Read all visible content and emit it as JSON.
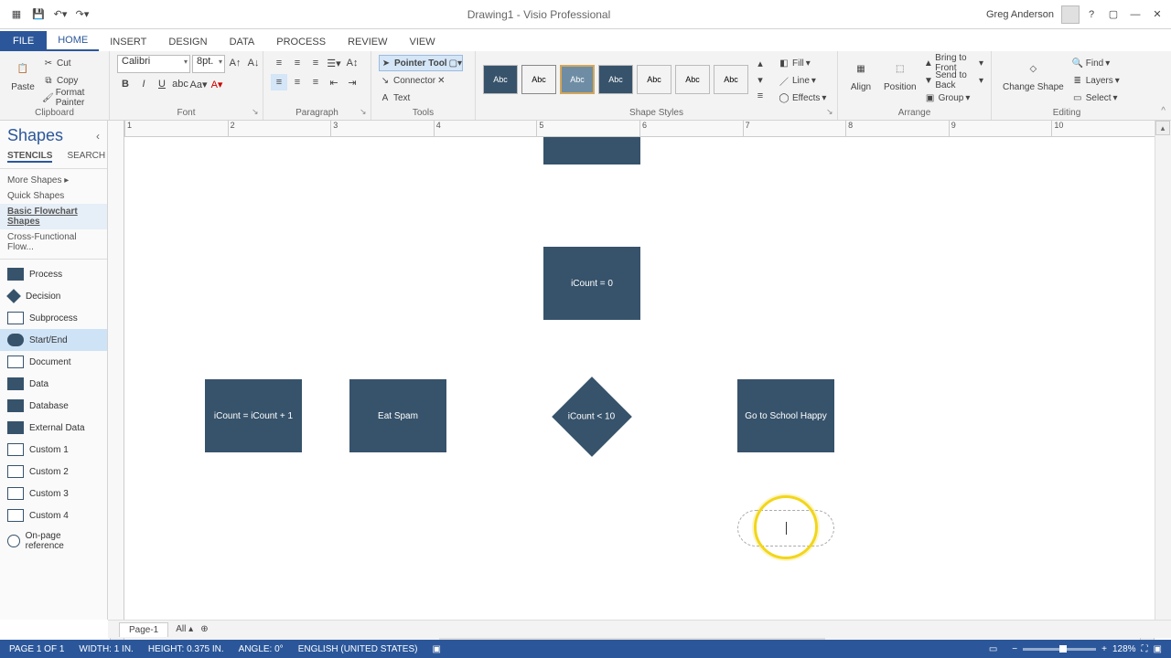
{
  "title": "Drawing1 - Visio Professional",
  "user": "Greg Anderson",
  "tabs": [
    "FILE",
    "HOME",
    "INSERT",
    "DESIGN",
    "DATA",
    "PROCESS",
    "REVIEW",
    "VIEW"
  ],
  "activeTab": "HOME",
  "ribbon": {
    "groups": {
      "clipboard": "Clipboard",
      "font": "Font",
      "paragraph": "Paragraph",
      "tools": "Tools",
      "styles": "Shape Styles",
      "arrange": "Arrange",
      "editing": "Editing"
    },
    "clipboard": {
      "paste": "Paste",
      "cut": "Cut",
      "copy": "Copy",
      "painter": "Format Painter"
    },
    "font": {
      "name": "Calibri",
      "size": "8pt."
    },
    "tools": {
      "pointer": "Pointer Tool",
      "connector": "Connector",
      "text": "Text"
    },
    "styles": {
      "fill": "Fill",
      "line": "Line",
      "effects": "Effects"
    },
    "arrange": {
      "align": "Align",
      "position": "Position",
      "bringfront": "Bring to Front",
      "sendback": "Send to Back",
      "group": "Group"
    },
    "editing": {
      "changeshape": "Change Shape",
      "find": "Find",
      "layers": "Layers",
      "select": "Select"
    }
  },
  "shapespane": {
    "title": "Shapes",
    "tabs": {
      "stencils": "STENCILS",
      "search": "SEARCH"
    },
    "groups": [
      "More Shapes",
      "Quick Shapes",
      "Basic Flowchart Shapes",
      "Cross-Functional Flow..."
    ],
    "selectedGroup": "Basic Flowchart Shapes",
    "items": [
      "Process",
      "Decision",
      "Subprocess",
      "Start/End",
      "Document",
      "Data",
      "Database",
      "External Data",
      "Custom 1",
      "Custom 2",
      "Custom 3",
      "Custom 4",
      "On-page reference"
    ],
    "highlighted": "Start/End"
  },
  "canvas": {
    "shapes": {
      "topRect": "",
      "icountInit": "iCount = 0",
      "icountInc": "iCount = iCount + 1",
      "eatSpam": "Eat Spam",
      "decision": "iCount < 10",
      "goSchool": "Go to School Happy"
    },
    "rulerMarks": [
      "1",
      "2",
      "3",
      "4",
      "5",
      "6",
      "7",
      "8",
      "9",
      "10"
    ]
  },
  "pagetabs": {
    "page1": "Page-1",
    "all": "All"
  },
  "status": {
    "page": "PAGE 1 OF 1",
    "width": "WIDTH: 1 IN.",
    "height": "HEIGHT: 0.375 IN.",
    "angle": "ANGLE: 0°",
    "lang": "ENGLISH (UNITED STATES)",
    "zoom": "128%"
  },
  "styleSwatchLabel": "Abc"
}
